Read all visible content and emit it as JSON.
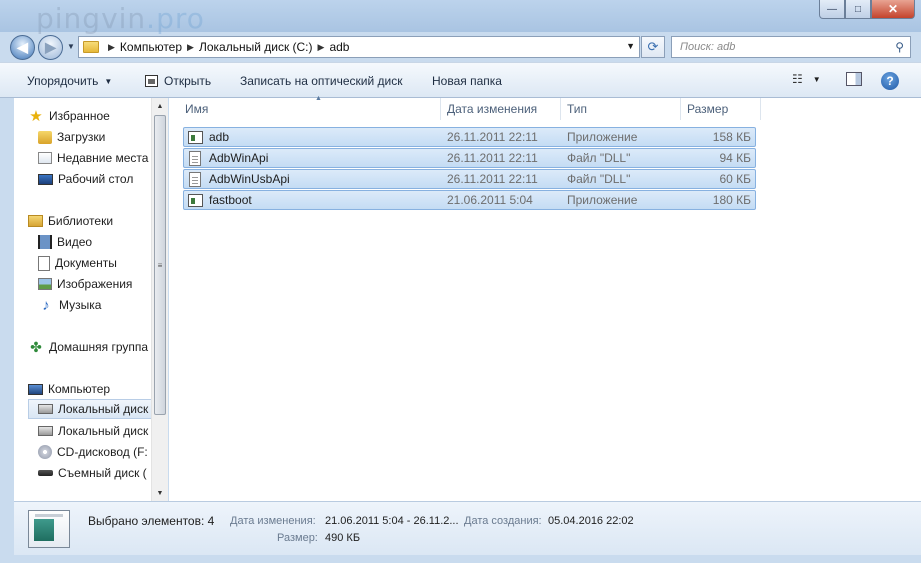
{
  "window": {
    "watermark_main": "pingvin",
    "watermark_suffix": ".pro",
    "minimize_glyph": "—",
    "maximize_glyph": "□",
    "close_glyph": "✕"
  },
  "navigation": {
    "breadcrumb": [
      "Компьютер",
      "Локальный диск (C:)",
      "adb"
    ],
    "search_placeholder": "Поиск: adb"
  },
  "toolbar": {
    "organize_label": "Упорядочить",
    "open_label": "Открыть",
    "burn_label": "Записать на оптический диск",
    "new_folder_label": "Новая папка"
  },
  "sidebar": {
    "favorites_label": "Избранное",
    "favorites": [
      "Загрузки",
      "Недавние места",
      "Рабочий стол"
    ],
    "libraries_label": "Библиотеки",
    "libraries": [
      "Видео",
      "Документы",
      "Изображения",
      "Музыка"
    ],
    "homegroup_label": "Домашняя группа",
    "computer_label": "Компьютер",
    "drives": [
      "Локальный диск",
      "Локальный диск",
      "CD-дисковод (F:",
      "Съемный диск ("
    ]
  },
  "file_list": {
    "columns": {
      "name": "Имя",
      "date": "Дата изменения",
      "type": "Тип",
      "size": "Размер"
    },
    "rows": [
      {
        "name": "adb",
        "date": "26.11.2011 22:11",
        "type": "Приложение",
        "size": "158 КБ",
        "icon": "exe-icon"
      },
      {
        "name": "AdbWinApi",
        "date": "26.11.2011 22:11",
        "type": "Файл \"DLL\"",
        "size": "94 КБ",
        "icon": "dll-icon"
      },
      {
        "name": "AdbWinUsbApi",
        "date": "26.11.2011 22:11",
        "type": "Файл \"DLL\"",
        "size": "60 КБ",
        "icon": "dll-icon"
      },
      {
        "name": "fastboot",
        "date": "21.06.2011 5:04",
        "type": "Приложение",
        "size": "180 КБ",
        "icon": "exe-icon"
      }
    ]
  },
  "details": {
    "selected_count": "Выбрано элементов: 4",
    "modified_label": "Дата изменения:",
    "modified_value": "21.06.2011 5:04 - 26.11.2...",
    "created_label": "Дата создания:",
    "created_value": "05.04.2016 22:02",
    "size_label": "Размер:",
    "size_value": "490 КБ"
  },
  "colors": {
    "selection_fill": "#c4dcf4",
    "selection_border": "#87b1e0",
    "frame": "#c9dbee"
  }
}
